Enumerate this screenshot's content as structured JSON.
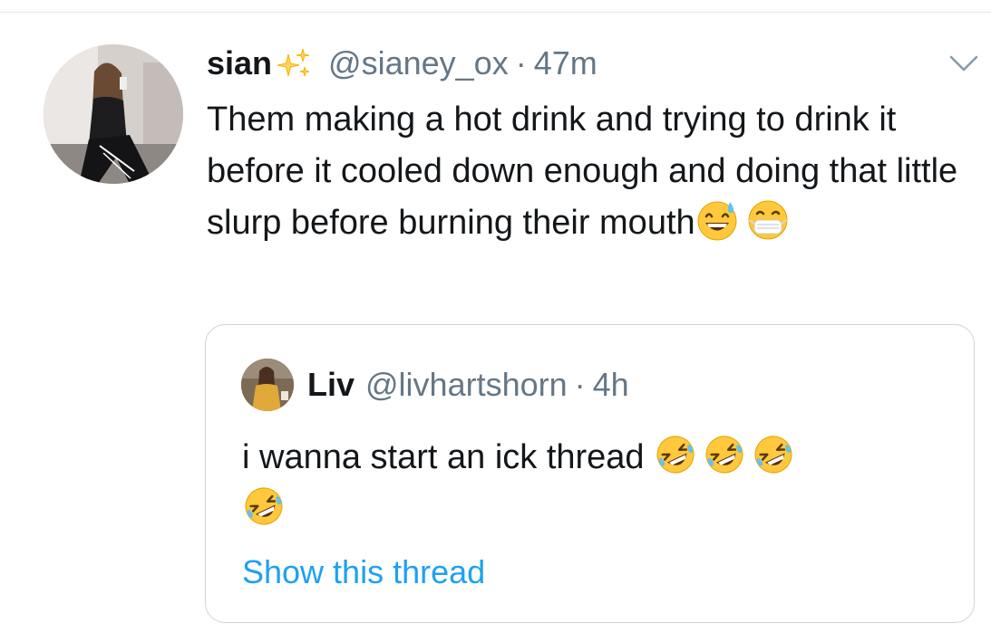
{
  "tweet": {
    "display_name": "sian",
    "name_emoji": "sparkles-icon",
    "handle": "@sianey_ox",
    "separator": "·",
    "time": "47m",
    "text": "Them making a hot drink and trying to drink it before it cooled down enough and doing that little slurp before burning their mouth",
    "text_emojis": [
      "grinning-sweat-emoji",
      "medical-mask-emoji"
    ],
    "menu_icon": "chevron-down-icon"
  },
  "quote": {
    "display_name": "Liv",
    "handle": "@livhartshorn",
    "separator": "·",
    "time": "4h",
    "text": "i wanna start an ick thread",
    "text_emojis": [
      "rofl-emoji",
      "rofl-emoji",
      "rofl-emoji",
      "rofl-emoji"
    ],
    "show_thread_label": "Show this thread"
  },
  "colors": {
    "primary_text": "#14171a",
    "secondary_text": "#657786",
    "link": "#1da1f2",
    "border": "#ccd6dd",
    "emoji_yellow": "#ffc83d"
  }
}
